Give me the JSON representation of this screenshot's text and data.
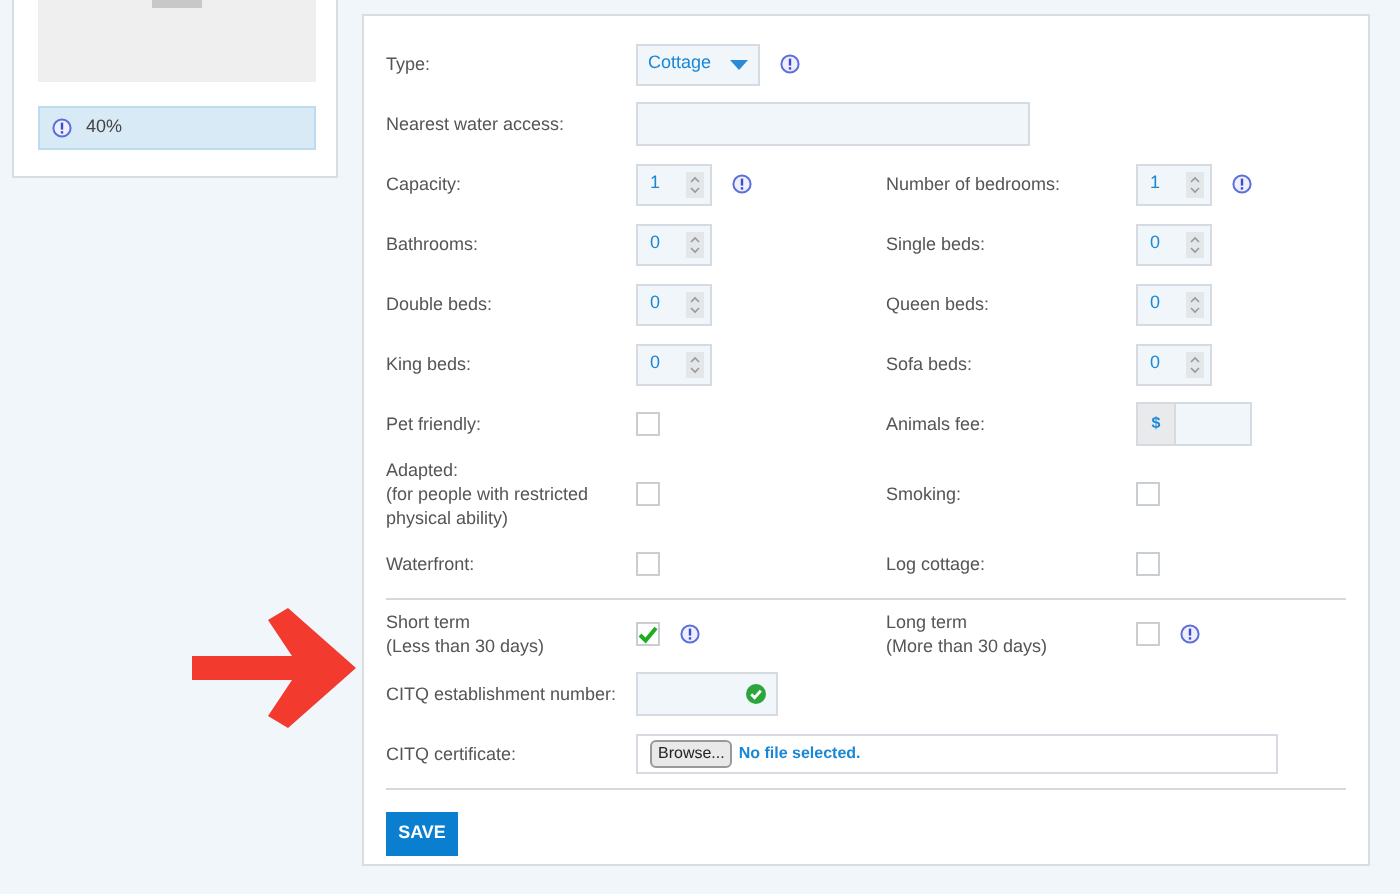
{
  "sidebar": {
    "progress": "40%"
  },
  "form": {
    "sections": [
      {
        "rows": [
          {
            "left": {
              "label": "Type:",
              "kind": "select",
              "value": "Cottage",
              "info": true
            }
          },
          {
            "left": {
              "label": "Nearest water access:",
              "kind": "text"
            }
          },
          {
            "left": {
              "label": "Capacity:",
              "kind": "number",
              "value": "1",
              "info": true
            },
            "right": {
              "label": "Number of bedrooms:",
              "kind": "number",
              "value": "1",
              "info": true
            }
          },
          {
            "left": {
              "label": "Bathrooms:",
              "kind": "number",
              "value": "0"
            },
            "right": {
              "label": "Single beds:",
              "kind": "number",
              "value": "0"
            }
          },
          {
            "left": {
              "label": "Double beds:",
              "kind": "number",
              "value": "0"
            },
            "right": {
              "label": "Queen beds:",
              "kind": "number",
              "value": "0"
            }
          },
          {
            "left": {
              "label": "King beds:",
              "kind": "number",
              "value": "0"
            },
            "right": {
              "label": "Sofa beds:",
              "kind": "number",
              "value": "0"
            }
          },
          {
            "left": {
              "label": "Pet friendly:",
              "kind": "checkbox",
              "checked": false
            },
            "right": {
              "label": "Animals fee:",
              "kind": "money",
              "prefix": "$"
            }
          },
          {
            "left": {
              "label": "Adapted:",
              "note": "(for people with restricted physical ability)",
              "kind": "checkbox",
              "checked": false
            },
            "right": {
              "label": "Smoking:",
              "kind": "checkbox",
              "checked": false
            }
          },
          {
            "left": {
              "label": "Waterfront:",
              "kind": "checkbox",
              "checked": false
            },
            "right": {
              "label": "Log cottage:",
              "kind": "checkbox",
              "checked": false
            }
          }
        ]
      },
      {
        "rows": [
          {
            "left": {
              "label": "Short term",
              "note": "(Less than 30 days)",
              "kind": "checkbox",
              "checked": true,
              "info": true
            },
            "right": {
              "label": "Long term",
              "note": "(More than 30 days)",
              "kind": "checkbox",
              "checked": false,
              "info": true
            }
          },
          {
            "left": {
              "label": "CITQ establishment number:",
              "kind": "code",
              "valid": true
            }
          },
          {
            "left": {
              "label": "CITQ certificate:",
              "kind": "file",
              "button": "Browse...",
              "status": "No file selected."
            }
          }
        ]
      }
    ]
  },
  "save": "SAVE"
}
